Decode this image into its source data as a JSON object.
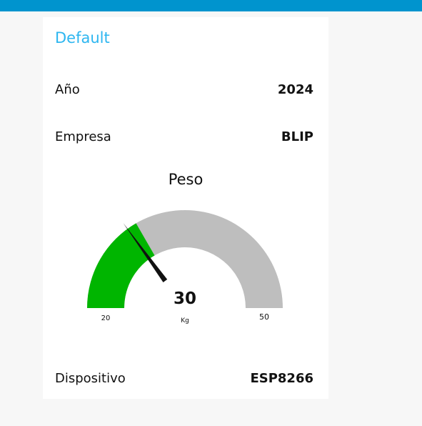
{
  "colors": {
    "header": "#0094ce",
    "group_title": "#2db6f0",
    "gauge_fill": "#00b500",
    "gauge_track": "#bebebe",
    "needle": "#111111"
  },
  "group": {
    "title": "Default"
  },
  "rows": [
    {
      "label": "Año",
      "value": "2024"
    },
    {
      "label": "Empresa",
      "value": "BLIP"
    }
  ],
  "gauge": {
    "title": "Peso",
    "value": 30,
    "value_text": "30",
    "units": "Kg",
    "min": 20,
    "max": 50,
    "min_label": "20",
    "max_label": "50",
    "needle_value": 29
  },
  "footer_row": {
    "label": "Dispositivo",
    "value": "ESP8266"
  }
}
